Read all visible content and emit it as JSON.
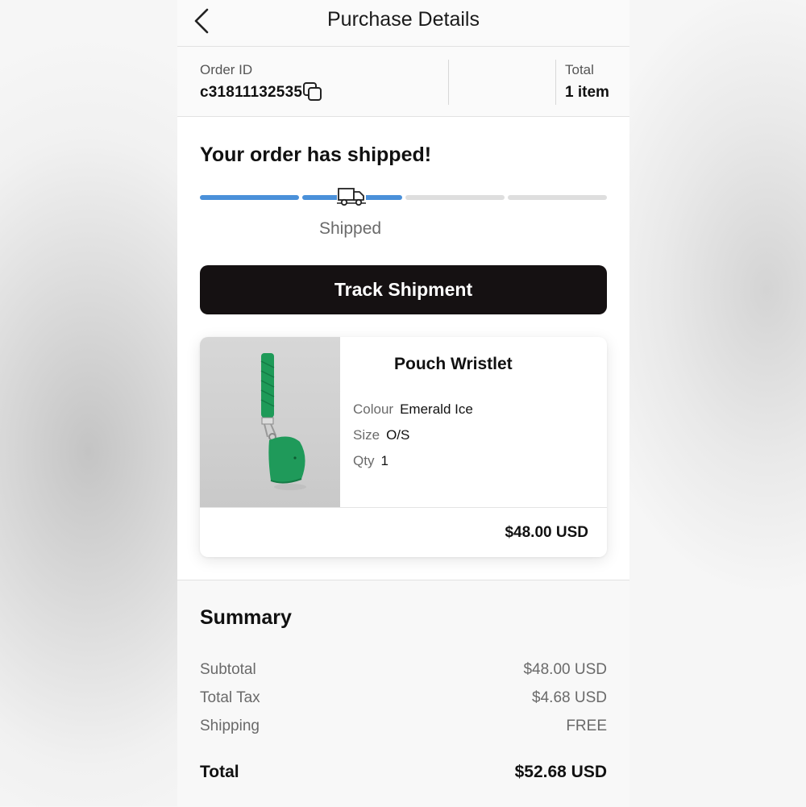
{
  "header": {
    "title": "Purchase Details",
    "back_icon": "chevron-left-icon"
  },
  "order": {
    "id_label": "Order ID",
    "id_value": "c31811132535",
    "copy_icon": "copy-icon",
    "total_label": "Total",
    "total_value": "1 item"
  },
  "shipment": {
    "heading": "Your order has shipped!",
    "status_label": "Shipped",
    "progress_steps": 4,
    "progress_completed": 2,
    "truck_icon": "truck-icon",
    "track_button_label": "Track Shipment"
  },
  "item": {
    "name": "Pouch Wristlet",
    "attributes": [
      {
        "key": "Colour",
        "value": "Emerald Ice"
      },
      {
        "key": "Size",
        "value": "O/S"
      },
      {
        "key": "Qty",
        "value": "1"
      }
    ],
    "price": "$48.00 USD"
  },
  "summary": {
    "title": "Summary",
    "rows": [
      {
        "label": "Subtotal",
        "value": "$48.00 USD"
      },
      {
        "label": "Total Tax",
        "value": "$4.68 USD"
      },
      {
        "label": "Shipping",
        "value": "FREE"
      }
    ],
    "total_label": "Total",
    "total_value": "$52.68 USD"
  },
  "colors": {
    "progress_active": "#4a90d9",
    "progress_inactive": "#dedede",
    "button_bg": "#151112",
    "product_color": "#1f9a5a"
  }
}
